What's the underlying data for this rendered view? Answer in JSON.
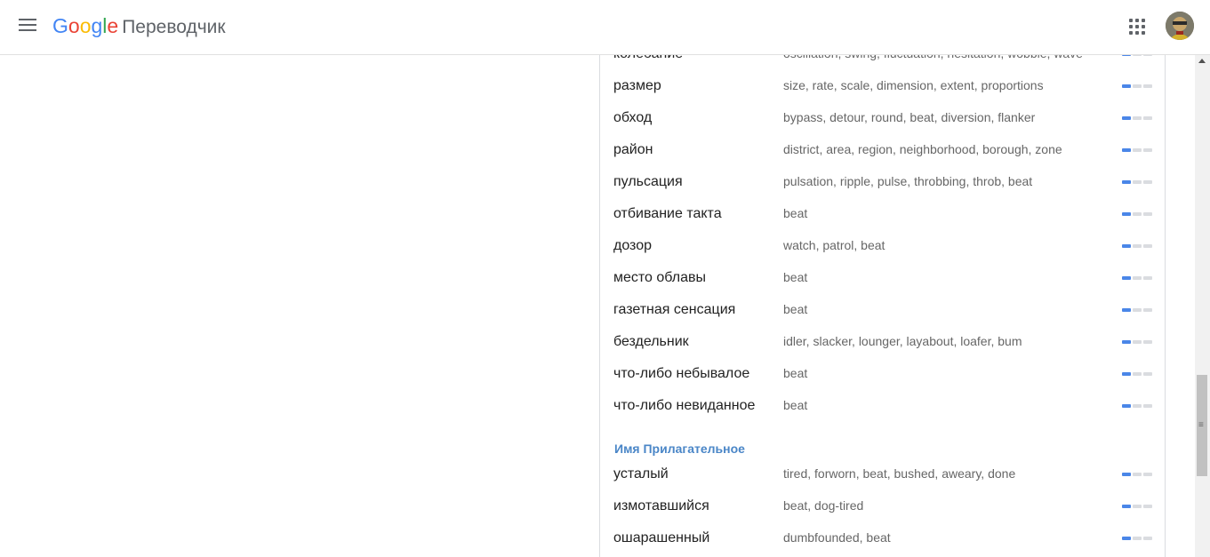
{
  "header": {
    "logo_letters": [
      "G",
      "o",
      "o",
      "g",
      "l",
      "e"
    ],
    "product": "Переводчик",
    "icons": {
      "menu": "hamburger-menu-icon",
      "apps": "apps-grid-icon",
      "avatar": "user-avatar"
    }
  },
  "colors": {
    "freq_active": "#4a86e8",
    "freq_inactive": "#dadce0",
    "section_title": "#4a86c7",
    "synonyms": "#666666"
  },
  "noun_rows": [
    {
      "term": "колебание",
      "synonyms": "oscillation, swing, fluctuation, hesitation, wobble, wave",
      "frequency": 1
    },
    {
      "term": "размер",
      "synonyms": "size, rate, scale, dimension, extent, proportions",
      "frequency": 1
    },
    {
      "term": "обход",
      "synonyms": "bypass, detour, round, beat, diversion, flanker",
      "frequency": 1
    },
    {
      "term": "район",
      "synonyms": "district, area, region, neighborhood, borough, zone",
      "frequency": 1
    },
    {
      "term": "пульсация",
      "synonyms": "pulsation, ripple, pulse, throbbing, throb, beat",
      "frequency": 1
    },
    {
      "term": "отбивание такта",
      "synonyms": "beat",
      "frequency": 1
    },
    {
      "term": "дозор",
      "synonyms": "watch, patrol, beat",
      "frequency": 1
    },
    {
      "term": "место облавы",
      "synonyms": "beat",
      "frequency": 1
    },
    {
      "term": "газетная сенсация",
      "synonyms": "beat",
      "frequency": 1
    },
    {
      "term": "бездельник",
      "synonyms": "idler, slacker, lounger, layabout, loafer, bum",
      "frequency": 1
    },
    {
      "term": "что-либо небывалое",
      "synonyms": "beat",
      "frequency": 1
    },
    {
      "term": "что-либо невиданное",
      "synonyms": "beat",
      "frequency": 1
    }
  ],
  "adjective_section": {
    "title": "Имя Прилагательное",
    "rows": [
      {
        "term": "усталый",
        "synonyms": "tired, forworn, beat, bushed, aweary, done",
        "frequency": 1
      },
      {
        "term": "измотавшийся",
        "synonyms": "beat, dog-tired",
        "frequency": 1
      },
      {
        "term": "ошарашенный",
        "synonyms": "dumbfounded, beat",
        "frequency": 1
      }
    ]
  },
  "frequency_max": 3,
  "scrollbar": {
    "grip_glyph": "≡"
  }
}
